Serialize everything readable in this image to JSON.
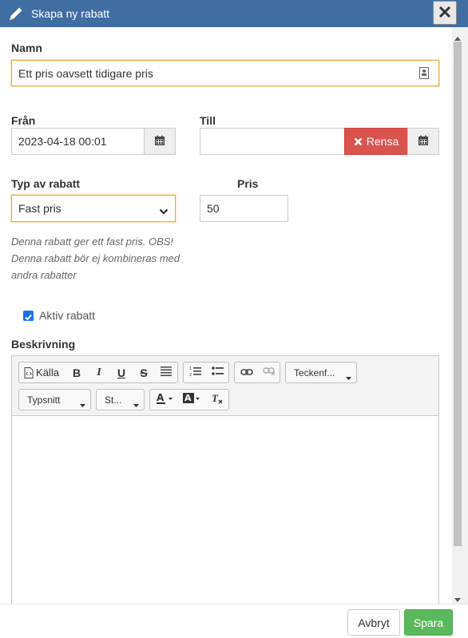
{
  "dialog": {
    "title": "Skapa ny rabatt",
    "close_label": "✕"
  },
  "form": {
    "name_label": "Namn",
    "name_value": "Ett pris oavsett tidigare pris",
    "from_label": "Från",
    "from_value": "2023-04-18 00:01",
    "to_label": "Till",
    "to_value": "",
    "clear_label": "Rensa",
    "type_label": "Typ av rabatt",
    "type_value": "Fast pris",
    "price_label": "Pris",
    "price_value": "50",
    "help_lines": [
      "Denna rabatt ger ett fast pris. OBS!",
      "Denna rabatt bör ej kombineras med",
      "andra rabatter"
    ],
    "active_label": "Aktiv rabatt",
    "active_checked": true,
    "description_label": "Beskrivning"
  },
  "editor": {
    "source_label": "Källa",
    "format_combo": "Teckenf...",
    "font_combo": "Typsnitt",
    "size_combo": "St..."
  },
  "footer": {
    "cancel_label": "Avbryt",
    "save_label": "Spara"
  },
  "colors": {
    "titlebar": "#3f6ea3",
    "danger": "#d9534f",
    "success": "#5cb85c",
    "focus": "#f0a940"
  }
}
